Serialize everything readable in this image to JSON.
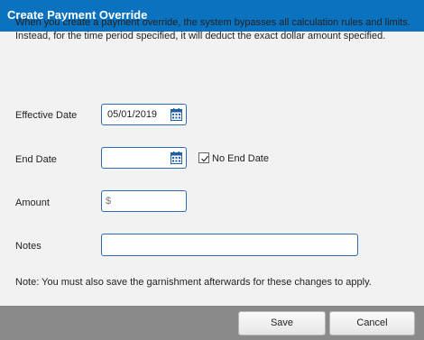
{
  "dialog": {
    "title": "Create Payment Override",
    "description": "When you create a payment override, the system bypasses all calculation rules and limits. Instead, for the time period specified, it will deduct the exact dollar amount specified."
  },
  "form": {
    "effective_date": {
      "label": "Effective Date",
      "value": "05/01/2019"
    },
    "end_date": {
      "label": "End Date",
      "value": ""
    },
    "no_end_date": {
      "label": "No End Date",
      "checked": true
    },
    "amount": {
      "label": "Amount",
      "prefix": "$",
      "value": ""
    },
    "notes": {
      "label": "Notes",
      "value": ""
    }
  },
  "note": "Note: You must also save the garnishment afterwards for these changes to apply.",
  "buttons": {
    "save": "Save",
    "cancel": "Cancel"
  },
  "icons": {
    "calendar": "calendar-icon",
    "checkmark": "checkmark-icon"
  },
  "colors": {
    "title_bar": "#0a72be",
    "field_border": "#2b6cb0",
    "footer": "#8a8a8a"
  }
}
